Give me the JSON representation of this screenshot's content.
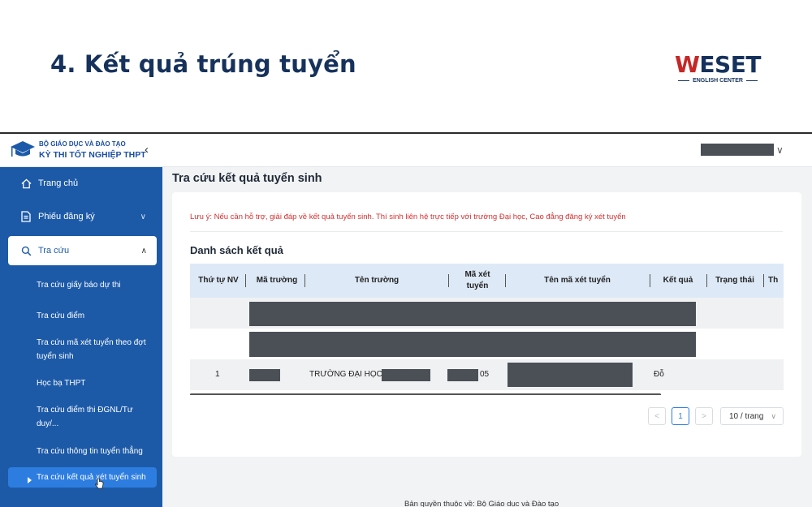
{
  "slide": {
    "title": "4. Kết quả trúng tuyển",
    "brand_w": "W",
    "brand_rest": "ESET",
    "brand_sub": "ENGLISH CENTER"
  },
  "app": {
    "org": "BỘ GIÁO DỤC VÀ ĐÀO TẠO",
    "name": "KỲ THI TỐT NGHIỆP THPT",
    "collapse_glyph": "‹",
    "user_caret": "∨"
  },
  "sidebar": {
    "items": [
      {
        "label": "Trang chủ",
        "icon": "home-icon"
      },
      {
        "label": "Phiếu đăng ký",
        "icon": "document-icon",
        "chevron": "∨"
      },
      {
        "label": "Tra cứu",
        "icon": "search-icon",
        "chevron": "∧"
      }
    ],
    "subitems": [
      "Tra cứu giấy báo dự thi",
      "Tra cứu điểm",
      "Tra cứu mã xét tuyển theo đợt tuyển sinh",
      "Học bạ THPT",
      "Tra cứu điểm thi ĐGNL/Tư duy/...",
      "Tra cứu thông tin tuyển thẳng",
      "Tra cứu kết quả xét tuyển sinh"
    ]
  },
  "main": {
    "heading": "Tra cứu kết quả tuyển sinh",
    "notice": "Lưu ý: Nếu cần hỗ trợ, giải đáp về kết quả tuyển sinh. Thí sinh liên hệ trực tiếp với trường Đại học, Cao đẳng đăng ký xét tuyển",
    "list_title": "Danh sách kết quả",
    "columns": [
      "Thứ tự NV",
      "Mã trường",
      "Tên trường",
      "Mã xét tuyển",
      "Tên mã xét tuyển",
      "Kết quả",
      "Trạng thái",
      "Th"
    ],
    "row": {
      "order": "1",
      "school_name": "TRƯỜNG ĐẠI HỌC",
      "code_suffix": "05",
      "result": "Đỗ"
    },
    "pagination": {
      "prev": "<",
      "current": "1",
      "next": ">",
      "page_size": "10 / trang",
      "size_chevron": "∨"
    }
  },
  "footer": {
    "text": "Bản quyền thuộc về: Bộ Giáo dục và Đào tạo"
  },
  "colors": {
    "sidebar": "#1c5aa8",
    "accent": "#2d7de0",
    "notice": "#d32f2f",
    "title": "#16325c",
    "brand_red": "#c62828"
  }
}
